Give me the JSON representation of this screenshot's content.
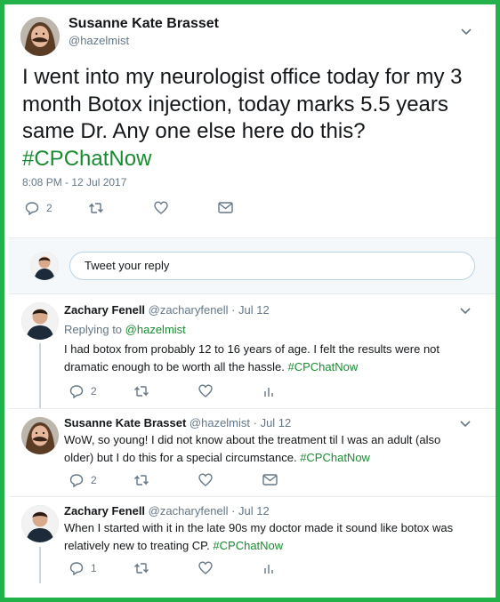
{
  "main_tweet": {
    "name": "Susanne Kate Brasset",
    "handle": "@hazelmist",
    "text": "I went into my neurologist office today for my 3 month Botox injection, today marks 5.5 years same Dr. Any one else here do this?",
    "hashtag": "#CPChatNow",
    "timestamp": "8:08 PM - 12 Jul 2017",
    "reply_count": "2"
  },
  "reply_box": {
    "placeholder": "Tweet your reply"
  },
  "replies": [
    {
      "name": "Zachary Fenell",
      "handle": "@zacharyfenell",
      "date": "· Jul 12",
      "replying_prefix": "Replying to",
      "replying_to": "@hazelmist",
      "text": "I had botox from probably 12 to 16 years of age. I felt the results were not dramatic enough to be worth all the hassle.",
      "hashtag": "#CPChatNow",
      "reply_count": "2"
    },
    {
      "name": "Susanne Kate Brasset",
      "handle": "@hazelmist",
      "date": "· Jul 12",
      "text": "WoW, so young! I did not know about the treatment til I was an adult (also older) but I do this for a special circumstance.",
      "hashtag": "#CPChatNow",
      "reply_count": "2"
    },
    {
      "name": "Zachary Fenell",
      "handle": "@zacharyfenell",
      "date": "· Jul 12",
      "text": "When I started with it in the late 90s my doctor made it sound like botox was relatively new to treating CP.",
      "hashtag": "#CPChatNow",
      "reply_count": "1"
    }
  ],
  "colors": {
    "border": "#21b34a",
    "hashtag": "#1a8b32",
    "muted": "#657786",
    "text": "#14171a"
  },
  "icons": [
    "chevron-down-icon",
    "reply-icon",
    "retweet-icon",
    "like-icon",
    "dm-icon",
    "analytics-icon"
  ]
}
